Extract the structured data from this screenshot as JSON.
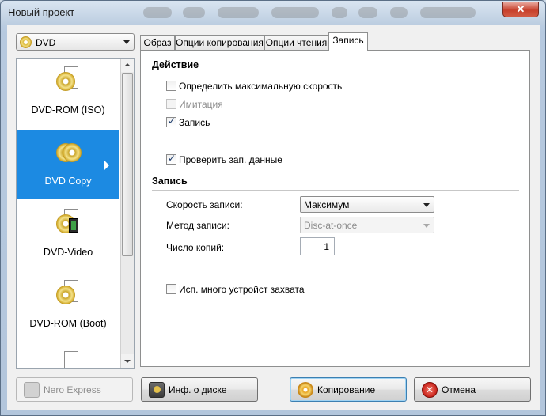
{
  "window": {
    "title": "Новый проект",
    "close_glyph": "✕"
  },
  "drive": {
    "selected": "DVD",
    "icon": "disc-icon"
  },
  "sidebar": {
    "items": [
      {
        "label": "DVD-ROM (ISO)",
        "icon": "dvd-rom-iso-icon",
        "active": false
      },
      {
        "label": "DVD Copy",
        "icon": "dvd-copy-icon",
        "active": true
      },
      {
        "label": "DVD-Video",
        "icon": "dvd-video-icon",
        "active": false
      },
      {
        "label": "DVD-ROM (Boot)",
        "icon": "dvd-rom-boot-icon",
        "active": false
      }
    ]
  },
  "tabs": [
    {
      "label": "Образ",
      "active": false
    },
    {
      "label": "Опции копирования",
      "active": false
    },
    {
      "label": "Опции чтения",
      "active": false
    },
    {
      "label": "Запись",
      "active": true
    }
  ],
  "panel": {
    "action_title": "Действие",
    "options": {
      "max_speed": {
        "label": "Определить максимальную скорость",
        "checked": false,
        "enabled": true
      },
      "simulation": {
        "label": "Имитация",
        "checked": false,
        "enabled": false
      },
      "write": {
        "label": "Запись",
        "checked": true,
        "enabled": true
      },
      "verify": {
        "label": "Проверить зап. данные",
        "checked": true,
        "enabled": true
      }
    },
    "write_title": "Запись",
    "write_speed": {
      "label": "Скорость записи:",
      "value": "Максимум"
    },
    "write_method": {
      "label": "Метод записи:",
      "value": "Disc-at-once",
      "enabled": false
    },
    "copies": {
      "label": "Число копий:",
      "value": "1"
    },
    "multi_device": {
      "label": "Исп. много устройст захвата",
      "checked": false
    }
  },
  "buttons": {
    "nero_express": {
      "label": "Nero Express",
      "enabled": false
    },
    "disc_info": {
      "label": "Инф. о диске"
    },
    "copy": {
      "label": "Копирование"
    },
    "cancel": {
      "label": "Отмена"
    }
  },
  "colors": {
    "selection": "#1c8ae2",
    "titlebar": "#bccde0",
    "close": "#c7402c"
  }
}
